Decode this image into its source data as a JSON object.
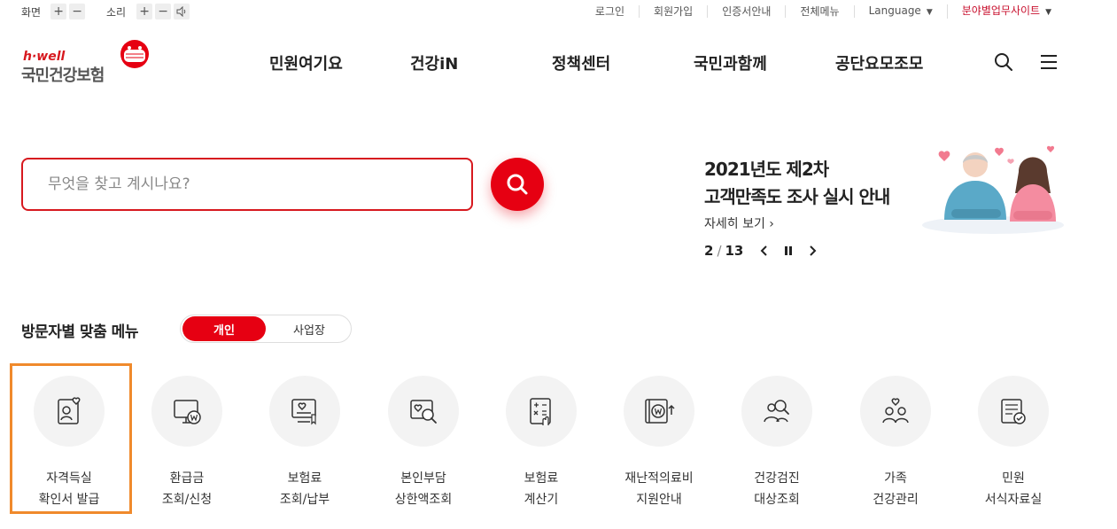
{
  "utility": {
    "screen_label": "화면",
    "sound_label": "소리",
    "plus": "+",
    "minus": "−",
    "links": [
      "로그인",
      "회원가입",
      "인증서안내",
      "전체메뉴"
    ],
    "language": "Language",
    "field_sites": "분야별업무사이트"
  },
  "logo": {
    "sub": "h·well",
    "name": "국민건강보험"
  },
  "gnb": [
    "민원여기요",
    "건강iN",
    "정책센터",
    "국민과함께",
    "공단요모조모"
  ],
  "search": {
    "placeholder": "무엇을 찾고 계시나요?"
  },
  "banner": {
    "title_line1": "2021년도 제2차",
    "title_line2": "고객만족도 조사 실시 안내",
    "more": "자세히 보기 ›",
    "current": "2",
    "total": "13"
  },
  "visitor_menu": {
    "title": "방문자별 맞춤 메뉴",
    "tab_personal": "개인",
    "tab_business": "사업장",
    "items": [
      {
        "line1": "자격득실",
        "line2": "확인서 발급",
        "icon": "id-card-heart-icon"
      },
      {
        "line1": "환급금",
        "line2": "조회/신청",
        "icon": "monitor-won-icon"
      },
      {
        "line1": "보험료",
        "line2": "조회/납부",
        "icon": "bill-heart-icon"
      },
      {
        "line1": "본인부담",
        "line2": "상한액조회",
        "icon": "search-heart-icon"
      },
      {
        "line1": "보험료",
        "line2": "계산기",
        "icon": "calculator-icon"
      },
      {
        "line1": "재난적의료비",
        "line2": "지원안내",
        "icon": "wallet-won-icon"
      },
      {
        "line1": "건강검진",
        "line2": "대상조회",
        "icon": "people-search-icon"
      },
      {
        "line1": "가족",
        "line2": "건강관리",
        "icon": "family-heart-icon"
      },
      {
        "line1": "민원",
        "line2": "서식자료실",
        "icon": "document-check-icon"
      }
    ]
  },
  "colors": {
    "brand_red": "#e60012",
    "focus_orange": "#f08a2c"
  }
}
